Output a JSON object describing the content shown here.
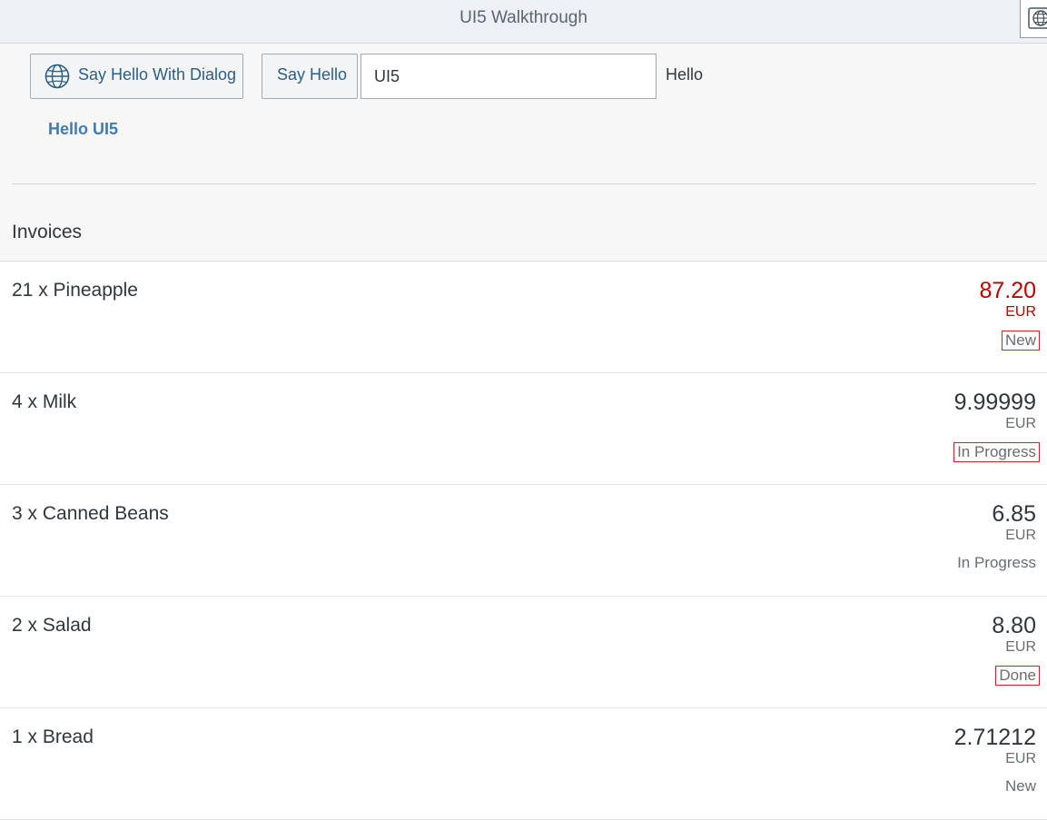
{
  "shell": {
    "title": "UI5 Walkthrough"
  },
  "toolbar": {
    "dialog_button_label": "Say Hello With Dialog",
    "hello_button_label": "Say Hello",
    "name_input_value": "UI5",
    "hello_label": "Hello"
  },
  "greeting": "Hello UI5",
  "invoices": {
    "header": "Invoices",
    "items": [
      {
        "title": "21 x Pineapple",
        "number": "87.20",
        "unit": "EUR",
        "status": "New",
        "number_state": "error",
        "status_boxed": true
      },
      {
        "title": "4 x Milk",
        "number": "9.99999",
        "unit": "EUR",
        "status": "In Progress",
        "number_state": "none",
        "status_boxed": true
      },
      {
        "title": "3 x Canned Beans",
        "number": "6.85",
        "unit": "EUR",
        "status": "In Progress",
        "number_state": "none",
        "status_boxed": false
      },
      {
        "title": "2 x Salad",
        "number": "8.80",
        "unit": "EUR",
        "status": "Done",
        "number_state": "none",
        "status_boxed": true
      },
      {
        "title": "1 x Bread",
        "number": "2.71212",
        "unit": "EUR",
        "status": "New",
        "number_state": "none",
        "status_boxed": false
      }
    ]
  },
  "colors": {
    "accent": "#427cac",
    "error": "#bb0000",
    "shell_bg": "#edf1f5"
  },
  "icons": {
    "dialog_button": "globe-icon",
    "shell_corner": "globe-icon"
  }
}
